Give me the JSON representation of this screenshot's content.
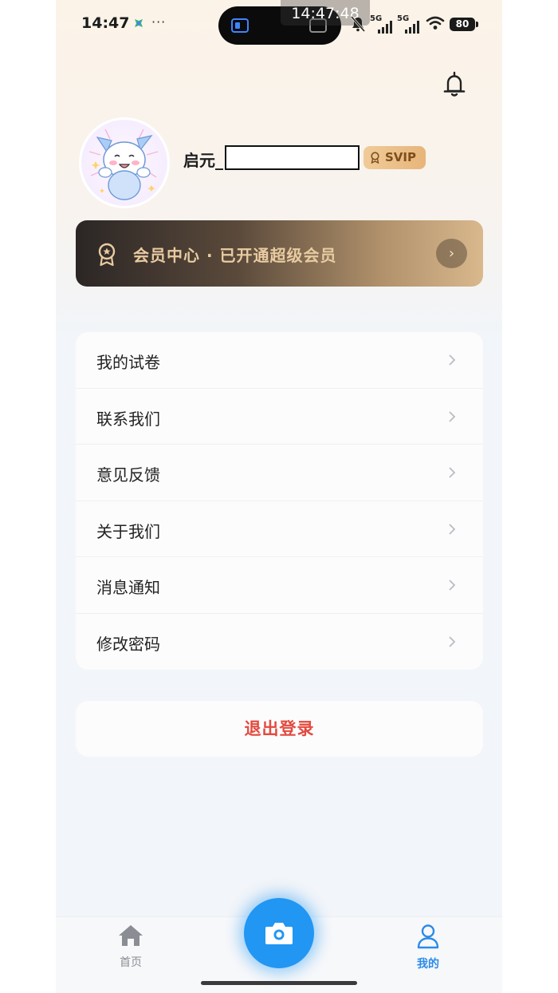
{
  "status_bar": {
    "time": "14:47",
    "overlay_time": "14:47:48",
    "dots": "···",
    "signal1_label": "5G",
    "signal2_label": "5G",
    "battery": "80"
  },
  "header": {
    "notification_icon": "bell-icon"
  },
  "profile": {
    "username": "启元_",
    "badge": "SVIP",
    "avatar": "cartoon-cat-avatar"
  },
  "vip_banner": {
    "label": "会员中心 · 已开通超级会员",
    "icon": "medal-icon",
    "arrow": "›"
  },
  "menu": {
    "items": [
      {
        "label": "我的试卷"
      },
      {
        "label": "联系我们"
      },
      {
        "label": "意见反馈"
      },
      {
        "label": "关于我们"
      },
      {
        "label": "消息通知"
      },
      {
        "label": "修改密码"
      }
    ]
  },
  "logout_label": "退出登录",
  "tabbar": {
    "home_label": "首页",
    "mine_label": "我的",
    "camera_icon": "camera-icon"
  },
  "colors": {
    "accent": "#2196f3",
    "logout": "#e34a3f",
    "svip_gold": "#e7b57a",
    "active_tab": "#2b8be8"
  }
}
